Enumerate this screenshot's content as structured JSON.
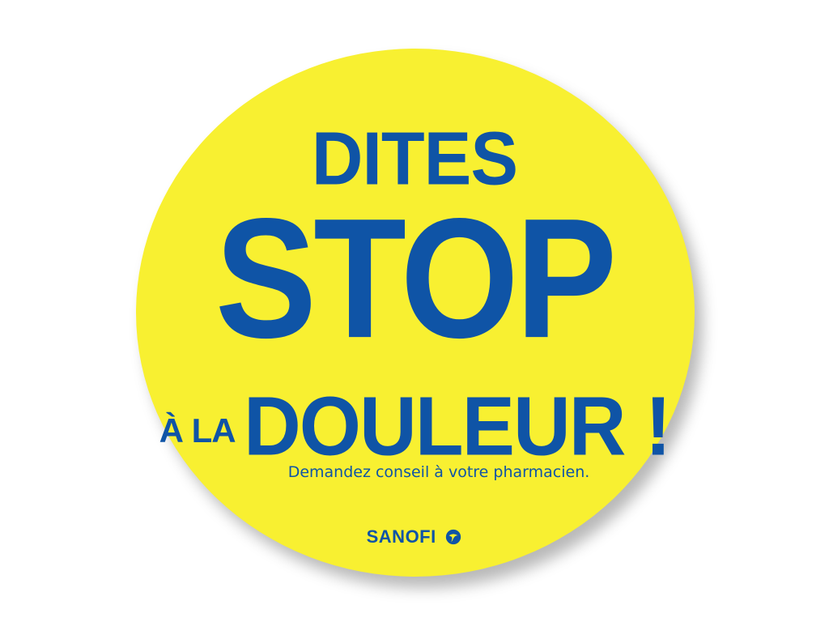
{
  "badge": {
    "line1": "DITES",
    "line2": "STOP",
    "line3_prefix": "À LA",
    "line3_main": "DOULEUR !",
    "tagline": "Demandez conseil à votre pharmacien.",
    "brand": "SANOFI"
  },
  "colors": {
    "badge_fill": "#f8f031",
    "text_blue": "#0f54a6",
    "background": "#ffffff"
  },
  "icons": [
    "sanofi-logo-icon"
  ]
}
